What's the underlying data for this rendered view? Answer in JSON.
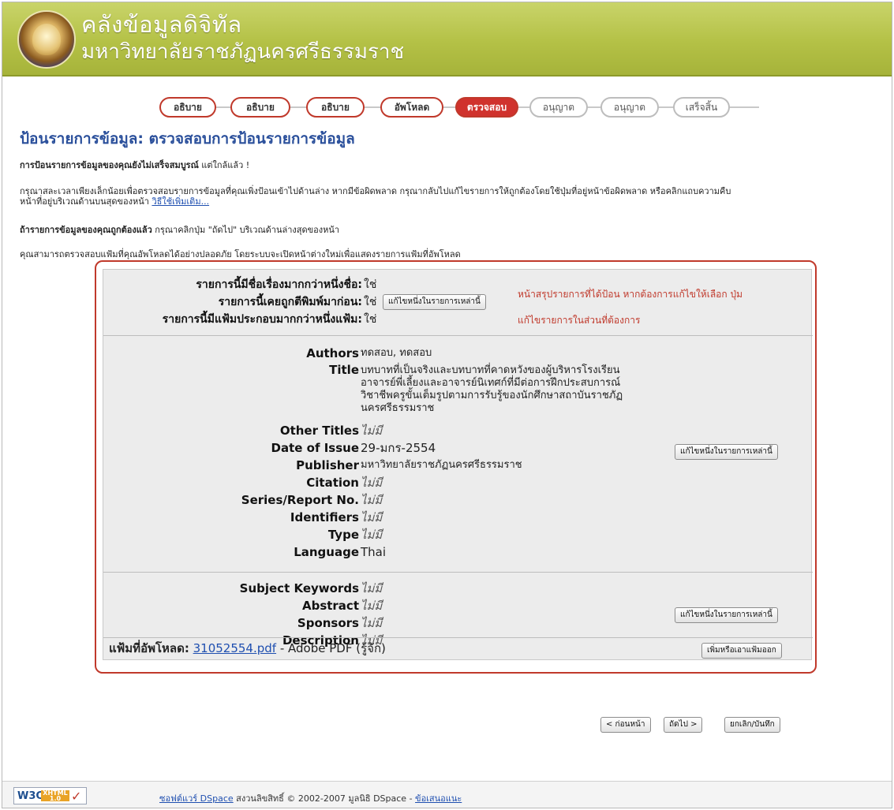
{
  "site": {
    "title": "คลังข้อมูลดิจิทัล",
    "subtitle": "มหาวิทยาลัยราชภัฏนครศรีธรรมราช"
  },
  "steps": [
    {
      "label": "อธิบาย",
      "state": "done"
    },
    {
      "label": "อธิบาย",
      "state": "done"
    },
    {
      "label": "อธิบาย",
      "state": "done"
    },
    {
      "label": "อัพโหลด",
      "state": "done"
    },
    {
      "label": "ตรวจสอบ",
      "state": "current"
    },
    {
      "label": "อนุญาต",
      "state": "todo"
    },
    {
      "label": "อนุญาต",
      "state": "todo"
    },
    {
      "label": "เสร็จสิ้น",
      "state": "todo"
    }
  ],
  "page_title": "ป้อนรายการข้อมูล: ตรวจสอบการป้อนรายการข้อมูล",
  "intro": {
    "p1_bold": "การป้อนรายการข้อมูลของคุณยังไม่เสร็จสมบูรณ์",
    "p1_rest": "แต่ใกล้แล้ว !",
    "p2_line1": "กรุณาสละเวลาเพียงเล็กน้อยเพื่อตรวจสอบรายการข้อมูลที่คุณเพิ่งป้อนเข้าไปด้านล่าง หากมีข้อผิดพลาด กรุณากลับไปแก้ไขรายการให้ถูกต้องโดยใช้ปุ่มที่อยู่หน้าข้อผิดพลาด หรือคลิกแถบความคืบ",
    "p2_line2": "หน้าที่อยู่บริเวณด้านบนสุดของหน้า",
    "p2_link": "วิธีใช้เพิ่มเติม...",
    "p3_bold": "ถ้ารายการข้อมูลของคุณถูกต้องแล้ว",
    "p3_rest": "กรุณาคลิกปุ่ม \"ถัดไป\" บริเวณด้านล่างสุดของหน้า",
    "p4": "คุณสามารถตรวจสอบแฟ้มที่คุณอัพโหลดได้อย่างปลอดภัย โดยระบบจะเปิดหน้าต่างใหม่เพื่อแสดงรายการแฟ้มที่อัพโหลด"
  },
  "section1": {
    "rows": [
      {
        "label": "รายการนี้มีชื่อเรื่องมากกว่าหนึ่งชื่อ:",
        "value": "ใช่"
      },
      {
        "label": "รายการนี้เคยถูกตีพิมพ์มาก่อน:",
        "value": "ใช่"
      },
      {
        "label": "รายการนี้มีแฟ้มประกอบมากกว่าหนึ่งแฟ้ม:",
        "value": "ใช่"
      }
    ],
    "edit_label": "แก้ไขหนึ่งในรายการเหล่านี้",
    "note_line1": "หน้าสรุปรายการที่ได้ป้อน หากต้องการแก้ไขให้เลือก ปุ่ม",
    "note_line2": "แก้ไขรายการในส่วนที่ต้องการ"
  },
  "section2": {
    "authors_label": "Authors",
    "authors_value": "ทดสอบ, ทดสอบ",
    "title_label": "Title",
    "title_lines": [
      "บทบาทที่เป็นจริงและบทบาทที่คาดหวังของผู้บริหารโรงเรียน",
      "อาจารย์พี่เลี้ยงและอาจารย์นิเทศก์ที่มีต่อการฝึกประสบการณ์",
      "วิชาชีพครูขั้นเต็มรูปตามการรับรู้ของนักศึกษาสถาบันราชภัฏ",
      "นครศรีธรรมราช"
    ],
    "other_titles_label": "Other Titles",
    "other_titles_value": "ไม่มี",
    "date_label": "Date of Issue",
    "date_value": "29-มกร-2554",
    "publisher_label": "Publisher",
    "publisher_value": "มหาวิทยาลัยราชภัฏนครศรีธรรมราช",
    "citation_label": "Citation",
    "citation_value": "ไม่มี",
    "series_label": "Series/Report No.",
    "series_value": "ไม่มี",
    "identifiers_label": "Identifiers",
    "identifiers_value": "ไม่มี",
    "type_label": "Type",
    "type_value": "ไม่มี",
    "language_label": "Language",
    "language_value": "Thai",
    "edit_label": "แก้ไขหนึ่งในรายการเหล่านี้"
  },
  "section3": {
    "keywords_label": "Subject Keywords",
    "keywords_value": "ไม่มี",
    "abstract_label": "Abstract",
    "abstract_value": "ไม่มี",
    "sponsors_label": "Sponsors",
    "sponsors_value": "ไม่มี",
    "description_label": "Description",
    "description_value": "ไม่มี",
    "edit_label": "แก้ไขหนึ่งในรายการเหล่านี้"
  },
  "files": {
    "label": "แฟ้มที่อัพโหลด:",
    "file_name": "31052554.pdf",
    "file_desc": "- Adobe PDF (รู้จัก)",
    "add_remove_label": "เพิ่มหรือเอาแฟ้มออก"
  },
  "nav": {
    "prev_label": "< ก่อนหน้า",
    "next_label": "ถัดไป >",
    "cancel_label": "ยกเลิก/บันทึก"
  },
  "footer": {
    "w3c": "W3C",
    "xhtml": "XHTML 1.0",
    "software_link": "ซอฟต์แวร์ DSpace",
    "copyright": "สงวนลิขสิทธิ์ © 2002-2007",
    "foundation": "มูลนิธิ DSpace",
    "separator": "-",
    "feedback_link": "ข้อเสนอแนะ"
  },
  "colors": {
    "accent_red": "#c0392b",
    "header_green": "#b4c146",
    "title_blue": "#2a4f9b",
    "link_blue": "#1f4fb0"
  }
}
